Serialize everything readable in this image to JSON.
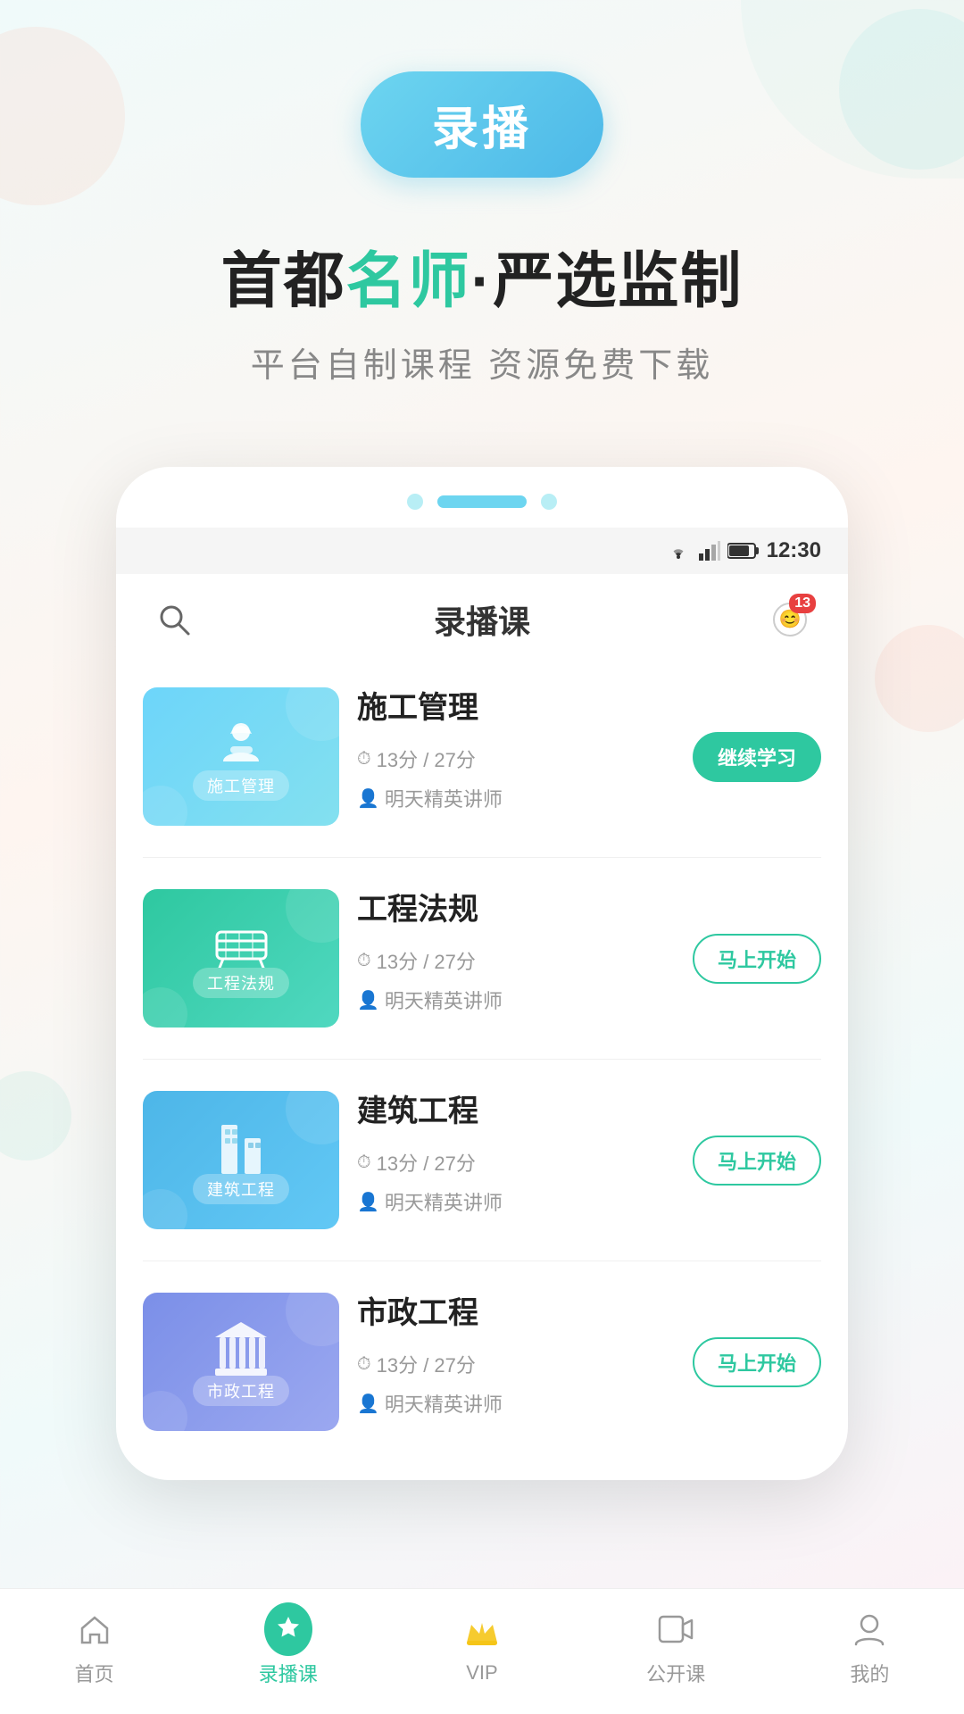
{
  "background": {
    "gradient": "linear-gradient(160deg, #f0fafa, #fef5f0, #f0fafa, #fef0f5)"
  },
  "header": {
    "badge_label": "录播",
    "tagline_prefix": "首都",
    "tagline_highlight": "名师",
    "tagline_middle": "·",
    "tagline_suffix": "严选监制",
    "subtitle": "平台自制课程  资源免费下载"
  },
  "status_bar": {
    "time": "12:30"
  },
  "app_header": {
    "title": "录播课",
    "notification_count": "13"
  },
  "courses": [
    {
      "id": 1,
      "name": "施工管理",
      "thumb_label": "施工管理",
      "thumb_class": "thumb-1",
      "thumb_icon": "🧑‍💼",
      "duration": "13分",
      "total": "27分",
      "teacher": "明天精英讲师",
      "action": "continue",
      "action_label": "继续学习"
    },
    {
      "id": 2,
      "name": "工程法规",
      "thumb_label": "工程法规",
      "thumb_class": "thumb-2",
      "thumb_icon": "🚧",
      "duration": "13分",
      "total": "27分",
      "teacher": "明天精英讲师",
      "action": "start",
      "action_label": "马上开始"
    },
    {
      "id": 3,
      "name": "建筑工程",
      "thumb_label": "建筑工程",
      "thumb_class": "thumb-3",
      "thumb_icon": "🏢",
      "duration": "13分",
      "total": "27分",
      "teacher": "明天精英讲师",
      "action": "start",
      "action_label": "马上开始"
    },
    {
      "id": 4,
      "name": "市政工程",
      "thumb_label": "市政工程",
      "thumb_class": "thumb-4",
      "thumb_icon": "🏛",
      "duration": "13分",
      "total": "27分",
      "teacher": "明天精英讲师",
      "action": "start",
      "action_label": "马上开始"
    }
  ],
  "bottom_nav": {
    "items": [
      {
        "id": "home",
        "label": "首页",
        "icon": "home",
        "active": false
      },
      {
        "id": "recording",
        "label": "录播课",
        "icon": "star",
        "active": true
      },
      {
        "id": "vip",
        "label": "VIP",
        "icon": "crown",
        "active": false
      },
      {
        "id": "live",
        "label": "公开课",
        "icon": "video",
        "active": false
      },
      {
        "id": "profile",
        "label": "我的",
        "icon": "person",
        "active": false
      }
    ]
  }
}
